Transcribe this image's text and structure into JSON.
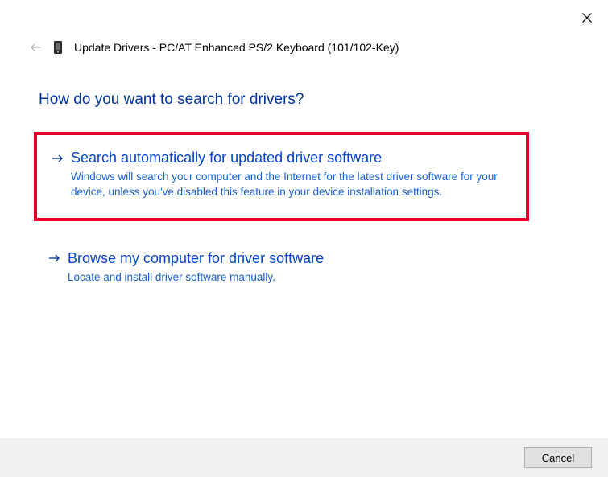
{
  "window": {
    "title": "Update Drivers - PC/AT Enhanced PS/2 Keyboard (101/102-Key)"
  },
  "heading": "How do you want to search for drivers?",
  "options": [
    {
      "title": "Search automatically for updated driver software",
      "description": "Windows will search your computer and the Internet for the latest driver software for your device, unless you've disabled this feature in your device installation settings.",
      "highlighted": true
    },
    {
      "title": "Browse my computer for driver software",
      "description": "Locate and install driver software manually.",
      "highlighted": false
    }
  ],
  "buttons": {
    "cancel": "Cancel"
  }
}
